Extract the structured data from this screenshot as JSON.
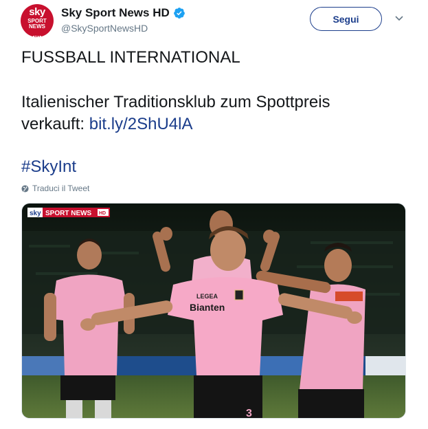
{
  "account": {
    "display_name": "Sky Sport News HD",
    "handle": "@SkySportNewsHD",
    "avatar_text": [
      "sky",
      "SPORT",
      "NEWS",
      "HD"
    ],
    "verified": true,
    "verified_color": "#1da1f2"
  },
  "actions": {
    "follow_label": "Segui",
    "menu_icon": "chevron-down-icon"
  },
  "tweet": {
    "heading": "FUSSBALL INTERNATIONAL",
    "body": "Italienischer Traditionsklub zum Spottpreis",
    "body_line2": "verkauft: ",
    "link_text": "bit.ly/2ShU4lA",
    "hashtag": "#SkyInt",
    "translate_label": "Traduci il Tweet"
  },
  "media": {
    "broadcast_logo": "sky SPORT NEWS HD",
    "kit_sponsor": "Bianten",
    "kit_brand": "LEGEA",
    "description_icon": "photo"
  },
  "colors": {
    "link": "#1b3d8b",
    "brand_red": "#c8102e",
    "secondary_text": "#657786",
    "kit_pink": "#f0a4c2"
  }
}
